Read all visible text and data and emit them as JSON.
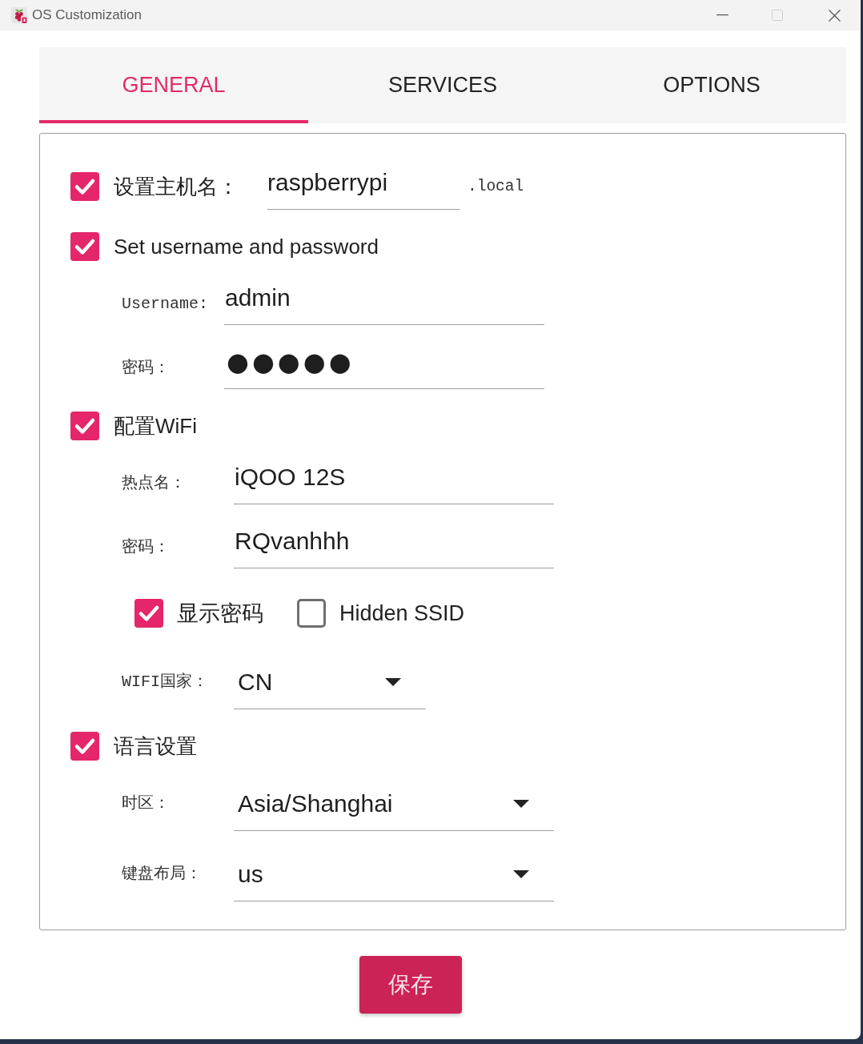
{
  "window": {
    "title": "OS Customization",
    "maximize_disabled": true
  },
  "tabs": [
    {
      "label": "GENERAL",
      "selected": true
    },
    {
      "label": "SERVICES",
      "selected": false
    },
    {
      "label": "OPTIONS",
      "selected": false
    }
  ],
  "sections": [
    {
      "kind": "hostname",
      "checked": true,
      "label": "设置主机名：",
      "value": "raspberrypi",
      "suffix": ".local"
    },
    {
      "kind": "group",
      "checked": true,
      "label": "Set username and password",
      "rows": [
        {
          "kind": "field",
          "label": "Username:",
          "value": "admin"
        },
        {
          "kind": "password",
          "label": "密码：",
          "value": "●●●●●"
        }
      ]
    },
    {
      "kind": "group",
      "checked": true,
      "label": "配置WiFi",
      "rows": [
        {
          "kind": "field",
          "label": "热点名：",
          "value": "iQOO 12S"
        },
        {
          "kind": "field",
          "label": "密码：",
          "value": "RQvanhhh"
        },
        {
          "kind": "toggles",
          "items": [
            {
              "label": "显示密码",
              "checked": true
            },
            {
              "label": "Hidden SSID",
              "checked": false
            }
          ]
        },
        {
          "kind": "select",
          "label": "WIFI国家：",
          "value": "CN"
        }
      ]
    },
    {
      "kind": "group",
      "checked": true,
      "label": "语言设置",
      "rows": [
        {
          "kind": "select",
          "label": "时区：",
          "value": "Asia/Shanghai"
        },
        {
          "kind": "select",
          "label": "键盘布局：",
          "value": "us"
        }
      ]
    }
  ],
  "save_button": {
    "label": "保存"
  }
}
